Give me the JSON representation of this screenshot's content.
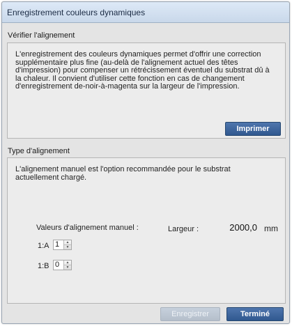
{
  "window": {
    "title": "Enregistrement couleurs dynamiques"
  },
  "check_section": {
    "label": "Vérifier l'alignement",
    "description_lines": [
      "L'enregistrement des couleurs dynamiques permet d'offrir une correction",
      "supplémentaire plus fine (au-delà de l'alignement actuel des têtes",
      "d'impression) pour compenser un rétrécissement éventuel du substrat dû à",
      "la chaleur. Il convient d'utiliser cette fonction en cas de changement",
      "d'enregistrement de-noir-à-magenta sur la largeur de l'impression."
    ],
    "print_button": "Imprimer"
  },
  "type_section": {
    "label": "Type d'alignement",
    "description_lines": [
      "L'alignement manuel est l'option recommandée pour le substrat",
      "actuellement chargé."
    ],
    "manual_values_label": "Valeurs d'alignement manuel :",
    "width_label": "Largeur :",
    "width_value": "2000,0",
    "width_unit": "mm",
    "fields": [
      {
        "label": "1:A",
        "value": "1"
      },
      {
        "label": "1:B",
        "value": "0"
      }
    ]
  },
  "footer": {
    "save_button": "Enregistrer",
    "done_button": "Terminé"
  },
  "colors": {
    "primary_button": "#3a629a",
    "disabled_button": "#bcc6d2",
    "title_bar": "#d3e0ef"
  }
}
